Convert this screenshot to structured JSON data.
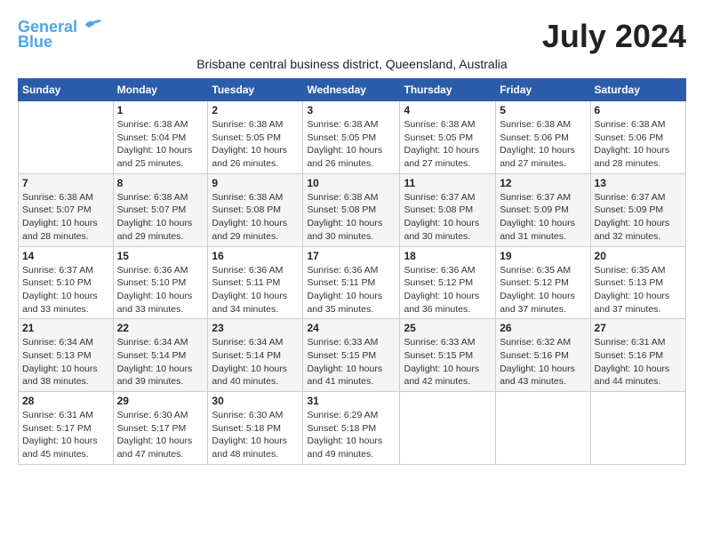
{
  "logo": {
    "line1": "General",
    "line2": "Blue"
  },
  "title": "July 2024",
  "subtitle": "Brisbane central business district, Queensland, Australia",
  "days_header": [
    "Sunday",
    "Monday",
    "Tuesday",
    "Wednesday",
    "Thursday",
    "Friday",
    "Saturday"
  ],
  "weeks": [
    [
      {
        "day": "",
        "info": ""
      },
      {
        "day": "1",
        "info": "Sunrise: 6:38 AM\nSunset: 5:04 PM\nDaylight: 10 hours\nand 25 minutes."
      },
      {
        "day": "2",
        "info": "Sunrise: 6:38 AM\nSunset: 5:05 PM\nDaylight: 10 hours\nand 26 minutes."
      },
      {
        "day": "3",
        "info": "Sunrise: 6:38 AM\nSunset: 5:05 PM\nDaylight: 10 hours\nand 26 minutes."
      },
      {
        "day": "4",
        "info": "Sunrise: 6:38 AM\nSunset: 5:05 PM\nDaylight: 10 hours\nand 27 minutes."
      },
      {
        "day": "5",
        "info": "Sunrise: 6:38 AM\nSunset: 5:06 PM\nDaylight: 10 hours\nand 27 minutes."
      },
      {
        "day": "6",
        "info": "Sunrise: 6:38 AM\nSunset: 5:06 PM\nDaylight: 10 hours\nand 28 minutes."
      }
    ],
    [
      {
        "day": "7",
        "info": "Sunrise: 6:38 AM\nSunset: 5:07 PM\nDaylight: 10 hours\nand 28 minutes."
      },
      {
        "day": "8",
        "info": "Sunrise: 6:38 AM\nSunset: 5:07 PM\nDaylight: 10 hours\nand 29 minutes."
      },
      {
        "day": "9",
        "info": "Sunrise: 6:38 AM\nSunset: 5:08 PM\nDaylight: 10 hours\nand 29 minutes."
      },
      {
        "day": "10",
        "info": "Sunrise: 6:38 AM\nSunset: 5:08 PM\nDaylight: 10 hours\nand 30 minutes."
      },
      {
        "day": "11",
        "info": "Sunrise: 6:37 AM\nSunset: 5:08 PM\nDaylight: 10 hours\nand 30 minutes."
      },
      {
        "day": "12",
        "info": "Sunrise: 6:37 AM\nSunset: 5:09 PM\nDaylight: 10 hours\nand 31 minutes."
      },
      {
        "day": "13",
        "info": "Sunrise: 6:37 AM\nSunset: 5:09 PM\nDaylight: 10 hours\nand 32 minutes."
      }
    ],
    [
      {
        "day": "14",
        "info": "Sunrise: 6:37 AM\nSunset: 5:10 PM\nDaylight: 10 hours\nand 33 minutes."
      },
      {
        "day": "15",
        "info": "Sunrise: 6:36 AM\nSunset: 5:10 PM\nDaylight: 10 hours\nand 33 minutes."
      },
      {
        "day": "16",
        "info": "Sunrise: 6:36 AM\nSunset: 5:11 PM\nDaylight: 10 hours\nand 34 minutes."
      },
      {
        "day": "17",
        "info": "Sunrise: 6:36 AM\nSunset: 5:11 PM\nDaylight: 10 hours\nand 35 minutes."
      },
      {
        "day": "18",
        "info": "Sunrise: 6:36 AM\nSunset: 5:12 PM\nDaylight: 10 hours\nand 36 minutes."
      },
      {
        "day": "19",
        "info": "Sunrise: 6:35 AM\nSunset: 5:12 PM\nDaylight: 10 hours\nand 37 minutes."
      },
      {
        "day": "20",
        "info": "Sunrise: 6:35 AM\nSunset: 5:13 PM\nDaylight: 10 hours\nand 37 minutes."
      }
    ],
    [
      {
        "day": "21",
        "info": "Sunrise: 6:34 AM\nSunset: 5:13 PM\nDaylight: 10 hours\nand 38 minutes."
      },
      {
        "day": "22",
        "info": "Sunrise: 6:34 AM\nSunset: 5:14 PM\nDaylight: 10 hours\nand 39 minutes."
      },
      {
        "day": "23",
        "info": "Sunrise: 6:34 AM\nSunset: 5:14 PM\nDaylight: 10 hours\nand 40 minutes."
      },
      {
        "day": "24",
        "info": "Sunrise: 6:33 AM\nSunset: 5:15 PM\nDaylight: 10 hours\nand 41 minutes."
      },
      {
        "day": "25",
        "info": "Sunrise: 6:33 AM\nSunset: 5:15 PM\nDaylight: 10 hours\nand 42 minutes."
      },
      {
        "day": "26",
        "info": "Sunrise: 6:32 AM\nSunset: 5:16 PM\nDaylight: 10 hours\nand 43 minutes."
      },
      {
        "day": "27",
        "info": "Sunrise: 6:31 AM\nSunset: 5:16 PM\nDaylight: 10 hours\nand 44 minutes."
      }
    ],
    [
      {
        "day": "28",
        "info": "Sunrise: 6:31 AM\nSunset: 5:17 PM\nDaylight: 10 hours\nand 45 minutes."
      },
      {
        "day": "29",
        "info": "Sunrise: 6:30 AM\nSunset: 5:17 PM\nDaylight: 10 hours\nand 47 minutes."
      },
      {
        "day": "30",
        "info": "Sunrise: 6:30 AM\nSunset: 5:18 PM\nDaylight: 10 hours\nand 48 minutes."
      },
      {
        "day": "31",
        "info": "Sunrise: 6:29 AM\nSunset: 5:18 PM\nDaylight: 10 hours\nand 49 minutes."
      },
      {
        "day": "",
        "info": ""
      },
      {
        "day": "",
        "info": ""
      },
      {
        "day": "",
        "info": ""
      }
    ]
  ]
}
